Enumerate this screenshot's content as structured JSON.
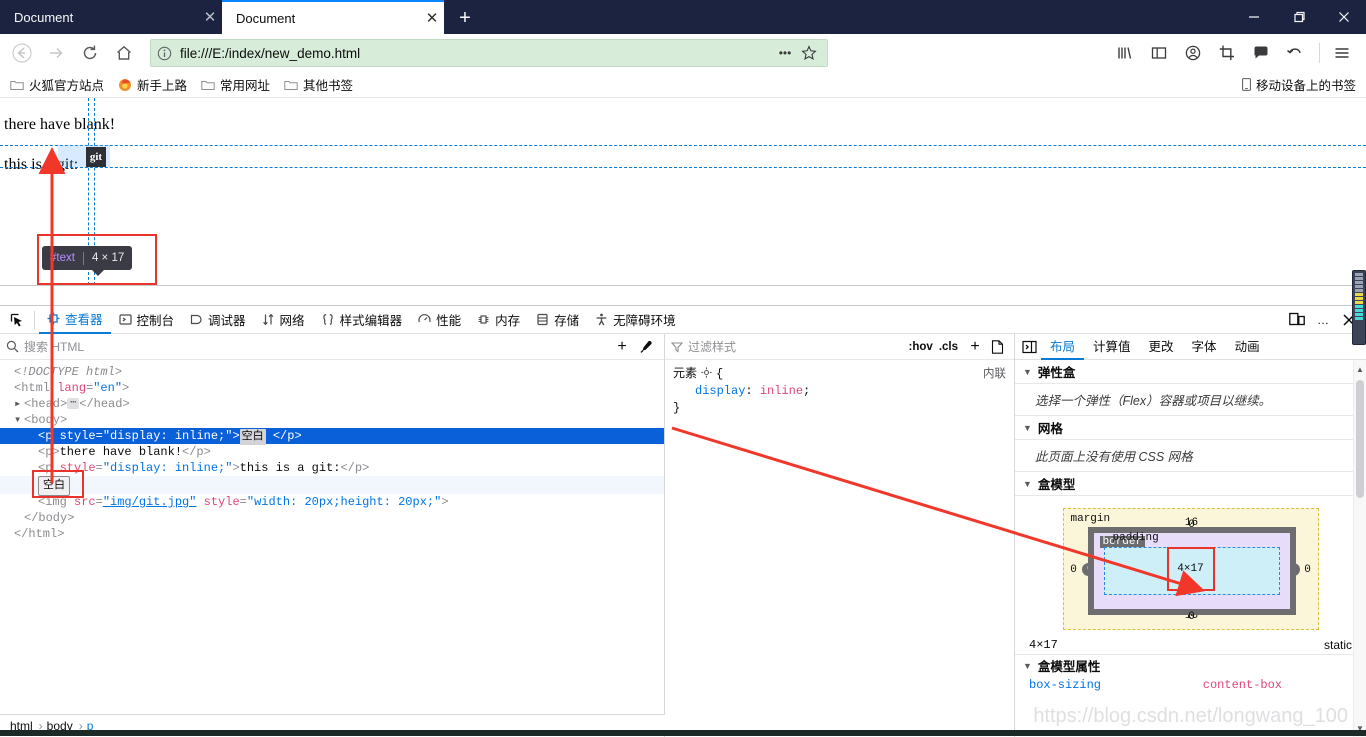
{
  "window": {
    "minimize_label": "—",
    "maximize_label": "❐",
    "close_label": "✕"
  },
  "tabs": [
    {
      "title": "Document",
      "close_label": "✕",
      "active": false
    },
    {
      "title": "Document",
      "close_label": "✕",
      "active": true
    }
  ],
  "newtab_label": "+",
  "navbar": {
    "back_label": "←",
    "forward_label": "→",
    "reload_label": "↻",
    "home_label": "⌂",
    "identity_icon": "info-circle-icon",
    "url": "file:///E:/index/new_demo.html",
    "page_actions_label": "•••",
    "bookmark_star_label": "☆",
    "right_icons": [
      "library-icon",
      "sidebar-icon",
      "account-icon",
      "screenshot-icon",
      "pocket-icon",
      "undo-icon",
      "menu-icon"
    ]
  },
  "bookmarks": {
    "items": [
      {
        "label": "火狐官方站点",
        "icon": "folder-icon"
      },
      {
        "label": "新手上路",
        "icon": "firefox-icon"
      },
      {
        "label": "常用网址",
        "icon": "folder-icon"
      },
      {
        "label": "其他书签",
        "icon": "folder-icon"
      }
    ],
    "mobile_label": "移动设备上的书签",
    "mobile_icon": "mobile-icon"
  },
  "page": {
    "line1": "there have blank!",
    "line2": "this is a git:",
    "image_alt": "git",
    "tooltip": {
      "node": "#text",
      "dims": "4 × 17"
    }
  },
  "devtools": {
    "tabs": [
      {
        "label": "查看器",
        "icon": "inspector-icon",
        "active": true
      },
      {
        "label": "控制台",
        "icon": "console-icon",
        "active": false
      },
      {
        "label": "调试器",
        "icon": "debugger-icon",
        "active": false
      },
      {
        "label": "网络",
        "icon": "network-icon",
        "active": false
      },
      {
        "label": "样式编辑器",
        "icon": "style-editor-icon",
        "active": false
      },
      {
        "label": "性能",
        "icon": "performance-icon",
        "active": false
      },
      {
        "label": "内存",
        "icon": "memory-icon",
        "active": false
      },
      {
        "label": "存储",
        "icon": "storage-icon",
        "active": false
      },
      {
        "label": "无障碍环境",
        "icon": "accessibility-icon",
        "active": false
      }
    ],
    "picker_icon": "element-picker-icon",
    "toolbar_right": {
      "responsive_icon": "responsive-design-icon",
      "meatball_label": "…",
      "close_label": "✕"
    },
    "search": {
      "placeholder": "搜索 HTML",
      "icon": "search-icon",
      "add_label": "+",
      "eyedropper_icon": "eyedropper-icon"
    },
    "markup": [
      {
        "indent": 0,
        "kind": "doctype",
        "text": "<!DOCTYPE html>"
      },
      {
        "indent": 0,
        "kind": "open",
        "tag": "html",
        "attrs": [
          {
            "name": "lang",
            "value": "en"
          }
        ]
      },
      {
        "indent": 1,
        "kind": "collapsed",
        "tag": "head",
        "twisty": "▶"
      },
      {
        "indent": 1,
        "kind": "open",
        "tag": "body",
        "twisty": "▼"
      },
      {
        "indent": 2,
        "kind": "element-sel",
        "tag": "p",
        "attrs": [
          {
            "name": "style",
            "value": "display: inline;"
          }
        ],
        "text": "空白",
        "selected": true
      },
      {
        "indent": 2,
        "kind": "element",
        "tag": "p",
        "text": "there have blank!"
      },
      {
        "indent": 2,
        "kind": "element",
        "tag": "p",
        "attrs": [
          {
            "name": "style",
            "value": "display: inline;"
          }
        ],
        "text": "this is a git:"
      },
      {
        "indent": 2,
        "kind": "whitespace",
        "text": "空白",
        "boxed": true
      },
      {
        "indent": 2,
        "kind": "void",
        "tag": "img",
        "attrs": [
          {
            "name": "src",
            "value": "img/git.jpg"
          },
          {
            "name": "style",
            "value": "width: 20px;height: 20px;"
          }
        ]
      },
      {
        "indent": 1,
        "kind": "close",
        "tag": "body"
      },
      {
        "indent": 0,
        "kind": "close",
        "tag": "html"
      }
    ],
    "rules": {
      "filter_placeholder": "过滤样式",
      "filter_icon": "filter-icon",
      "hov_label": ":hov",
      "cls_label": ".cls",
      "add_rule_label": "+",
      "print_icon": "stylesheet-icon",
      "selector": "元素",
      "source": "内联",
      "declarations": [
        {
          "property": "display",
          "value": "inline"
        }
      ]
    },
    "layout": {
      "expand_icon": "pane-toggle-icon",
      "tabs": [
        {
          "label": "布局",
          "active": true
        },
        {
          "label": "计算值",
          "active": false
        },
        {
          "label": "更改",
          "active": false
        },
        {
          "label": "字体",
          "active": false
        },
        {
          "label": "动画",
          "active": false
        }
      ],
      "sections": [
        {
          "title": "弹性盒",
          "body": "选择一个弹性（Flex）容器或项目以继续。"
        },
        {
          "title": "网格",
          "body": "此页面上没有使用 CSS 网格"
        },
        {
          "title": "盒模型",
          "body": ""
        }
      ],
      "box_model": {
        "margin_label": "margin",
        "border_label": "border",
        "padding_label": "padding",
        "content_size": "4×17",
        "margin_top": "16",
        "margin_bottom": "16",
        "margin_left": "0",
        "margin_right": "0",
        "border_top": "0",
        "border_bottom": "0",
        "border_left": "0",
        "border_right": "0",
        "padding_top": "0",
        "padding_bottom": "0",
        "padding_left": "0",
        "padding_right": "0"
      },
      "footer_size": "4×17",
      "footer_position": "static",
      "props_title": "盒模型属性",
      "props": [
        {
          "name": "box-sizing",
          "value": "content-box"
        }
      ]
    },
    "breadcrumb": [
      {
        "label": "html",
        "current": false
      },
      {
        "label": "body",
        "current": false
      },
      {
        "label": "p",
        "current": true
      }
    ],
    "breadcrumb_separator": "›"
  },
  "watermark": "https://blog.csdn.net/longwang_100"
}
